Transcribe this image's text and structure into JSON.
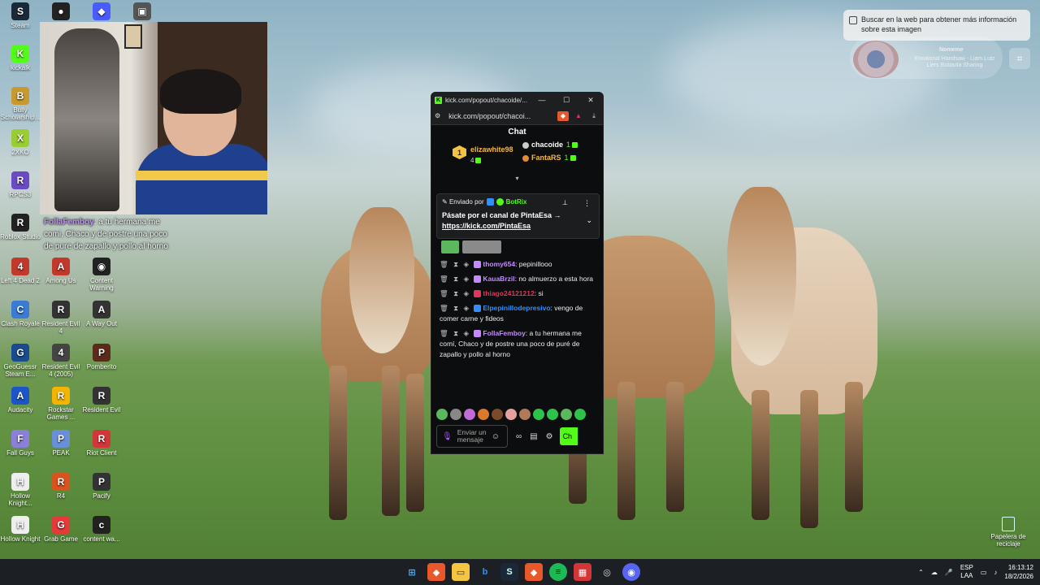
{
  "desktop": {
    "icons": [
      {
        "label": "Steam",
        "glyph": "S",
        "color": "#1b2838"
      },
      {
        "label": "",
        "glyph": "●",
        "color": "#222"
      },
      {
        "label": "",
        "glyph": "◆",
        "color": "#4a5cff"
      },
      {
        "label": "",
        "glyph": "▣",
        "color": "#555"
      },
      {
        "label": "kickalk",
        "glyph": "K",
        "color": "#53fc18"
      },
      {
        "label": "Bully Scholarship...",
        "glyph": "B",
        "color": "#c89a2e"
      },
      {
        "label": "2XKO",
        "glyph": "X",
        "color": "#9acd32"
      },
      {
        "label": "RPCS3",
        "glyph": "R",
        "color": "#6a4bc4"
      },
      {
        "label": "Roblox Studio",
        "glyph": "R",
        "color": "#222"
      },
      {
        "label": "Left 4 Dead 2",
        "glyph": "4",
        "color": "#c0392b"
      },
      {
        "label": "Among Us",
        "glyph": "A",
        "color": "#c0392b"
      },
      {
        "label": "Content Warning",
        "glyph": "◉",
        "color": "#222"
      },
      {
        "label": "Clash Royale",
        "glyph": "C",
        "color": "#3a7bd5"
      },
      {
        "label": "Resident Evil 4",
        "glyph": "R",
        "color": "#333"
      },
      {
        "label": "A Way Out",
        "glyph": "A",
        "color": "#333"
      },
      {
        "label": "GeoGuessr Steam E...",
        "glyph": "G",
        "color": "#1a4a8f"
      },
      {
        "label": "Resident Evil 4 (2005)",
        "glyph": "4",
        "color": "#444"
      },
      {
        "label": "Pomberito",
        "glyph": "P",
        "color": "#5a2a1a"
      },
      {
        "label": "Audacity",
        "glyph": "A",
        "color": "#1a56c9"
      },
      {
        "label": "Rockstar Games ...",
        "glyph": "R",
        "color": "#f5b400"
      },
      {
        "label": "Resident Evil",
        "glyph": "R",
        "color": "#333"
      },
      {
        "label": "Fall Guys",
        "glyph": "F",
        "color": "#8a7fd9"
      },
      {
        "label": "PEAK",
        "glyph": "P",
        "color": "#6a8fd9"
      },
      {
        "label": "Riot Client",
        "glyph": "R",
        "color": "#d13639"
      },
      {
        "label": "Hollow Knight...",
        "glyph": "H",
        "color": "#eee"
      },
      {
        "label": "R4",
        "glyph": "R",
        "color": "#d9531e"
      },
      {
        "label": "Pacify",
        "glyph": "P",
        "color": "#333"
      },
      {
        "label": "Hollow Knight",
        "glyph": "H",
        "color": "#eee"
      },
      {
        "label": "Grab Game",
        "glyph": "G",
        "color": "#e63939"
      },
      {
        "label": "content wa...",
        "glyph": "c",
        "color": "#222"
      }
    ],
    "recycle_bin": "Papelera de reciclaje"
  },
  "stream_overlay": {
    "user": "FollaFemboy",
    "text": ": a tu hermana me comi, Chaco y de postre una poco de pure de zapallo y pollo al horno"
  },
  "lens": {
    "popup_text": "Buscar en la web para obtener más información sobre esta imagen",
    "widget_title": "Nomeme",
    "widget_sub": "Emotional Handsaw - Liam Lutz Liers Bobaola Sharing"
  },
  "window": {
    "title": "kick.com/popout/chacoide/...",
    "url": "kick.com/popout/chacoi...",
    "minimize": "—",
    "maximize": "☐",
    "close": "✕"
  },
  "chat": {
    "header": "Chat",
    "leaderboard": {
      "rank": "1",
      "first_name": "elizawhite98",
      "first_count": "4",
      "second_name": "chacoide",
      "second_count": "1",
      "third_name": "FantaRS",
      "third_count": "1"
    },
    "pinned": {
      "sent_by": "Enviado por",
      "bot": "BotRix",
      "message": "Pásate por el canal de PintaEsa →",
      "link": "https://kick.com/PintaEsa"
    },
    "messages": [
      {
        "user": "thomy654",
        "user_color": "#c38bff",
        "text": ": pepinillooo"
      },
      {
        "user": "KauaBrzil",
        "user_color": "#c38bff",
        "text": ": no almuerzo a esta hora"
      },
      {
        "user": "thiago24121212",
        "user_color": "#e0365a",
        "text": ": si"
      },
      {
        "user": "Elpepinillodepresivo",
        "user_color": "#2f8fff",
        "text": ": vengo de comer carne y fideos"
      },
      {
        "user": "FollaFemboy",
        "user_color": "#c38bff",
        "text": ": a tu hermana me comí, Chaco y de postre una poco de puré de zapallo y pollo al horno"
      }
    ],
    "input_placeholder": "Enviar un mensaje",
    "send_label": "Ch"
  },
  "taskbar": {
    "lang_top": "ESP",
    "lang_bottom": "LAA",
    "time": "16:13:12",
    "date": "18/2/2026"
  }
}
